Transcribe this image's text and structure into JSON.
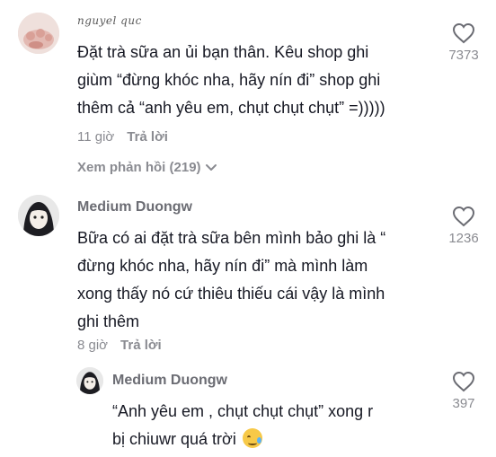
{
  "comments": [
    {
      "username": "nguyel quc",
      "text_lines": [
        "Đặt trà sữa an ủi bạn thân. Kêu shop ghi",
        "giùm “đừng khóc nha, hãy nín đi” shop ghi",
        "thêm cả “anh yêu em, chụt chụt chụt” =)))))"
      ],
      "time": "11 giờ",
      "reply_label": "Trả lời",
      "likes": "7373",
      "view_replies": "Xem phản hồi (219)"
    },
    {
      "username": "Medium Duongw",
      "text_lines": [
        "Bữa có ai đặt trà sữa bên mình bảo ghi là “",
        "đừng khóc nha, hãy nín đi” mà mình làm",
        "xong thấy nó cứ thiêu thiếu cái vậy là mình",
        "ghi thêm"
      ],
      "time": "8 giờ",
      "reply_label": "Trả lời",
      "likes": "1236"
    }
  ],
  "reply": {
    "username": "Medium Duongw",
    "text_lines": [
      "“Anh yêu em , chụt chụt chụt” xong r",
      "bị chiuwr quá trời"
    ],
    "likes": "397",
    "emoji": "face-holding-back-tears"
  },
  "icons": {
    "like": "heart-outline-icon",
    "expand": "chevron-down-icon"
  }
}
